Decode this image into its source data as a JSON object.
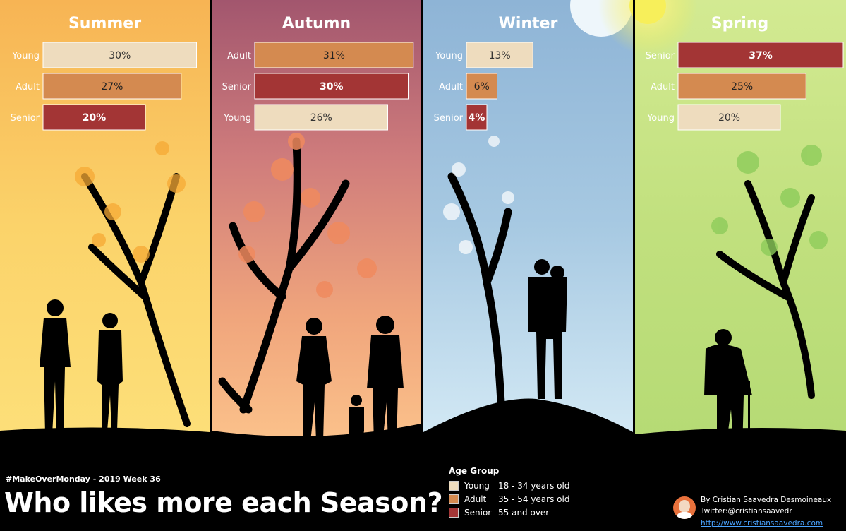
{
  "colors": {
    "Young": "#EEDCBE",
    "Adult": "#D48A50",
    "Senior": "#A33535"
  },
  "chart_data": {
    "type": "bar",
    "scale_max": 40,
    "panels": [
      {
        "title": "Summer",
        "rows": [
          {
            "category": "Young",
            "value": 30,
            "label": "30%"
          },
          {
            "category": "Adult",
            "value": 27,
            "label": "27%"
          },
          {
            "category": "Senior",
            "value": 20,
            "label": "20%"
          }
        ]
      },
      {
        "title": "Autumn",
        "rows": [
          {
            "category": "Adult",
            "value": 31,
            "label": "31%"
          },
          {
            "category": "Senior",
            "value": 30,
            "label": "30%"
          },
          {
            "category": "Young",
            "value": 26,
            "label": "26%"
          }
        ]
      },
      {
        "title": "Winter",
        "rows": [
          {
            "category": "Young",
            "value": 13,
            "label": "13%"
          },
          {
            "category": "Adult",
            "value": 6,
            "label": "6%"
          },
          {
            "category": "Senior",
            "value": 4,
            "label": "4%"
          }
        ]
      },
      {
        "title": "Spring",
        "rows": [
          {
            "category": "Senior",
            "value": 37,
            "label": "37%"
          },
          {
            "category": "Adult",
            "value": 25,
            "label": "25%"
          },
          {
            "category": "Young",
            "value": 20,
            "label": "20%"
          }
        ]
      }
    ]
  },
  "footer": {
    "tag": "#MakeOverMonday - 2019 Week 36",
    "title": "Who likes more each Season?"
  },
  "legend": {
    "title": "Age Group",
    "items": [
      {
        "label": "Young",
        "desc": "18 - 34 years old"
      },
      {
        "label": "Adult",
        "desc": "35 - 54 years old"
      },
      {
        "label": "Senior",
        "desc": "55 and over"
      }
    ]
  },
  "credits": {
    "author": "By Cristian Saavedra Desmoineaux",
    "twitter": "Twitter:@cristiansaavedr",
    "website": "http://www.cristiansaavedra.com"
  }
}
